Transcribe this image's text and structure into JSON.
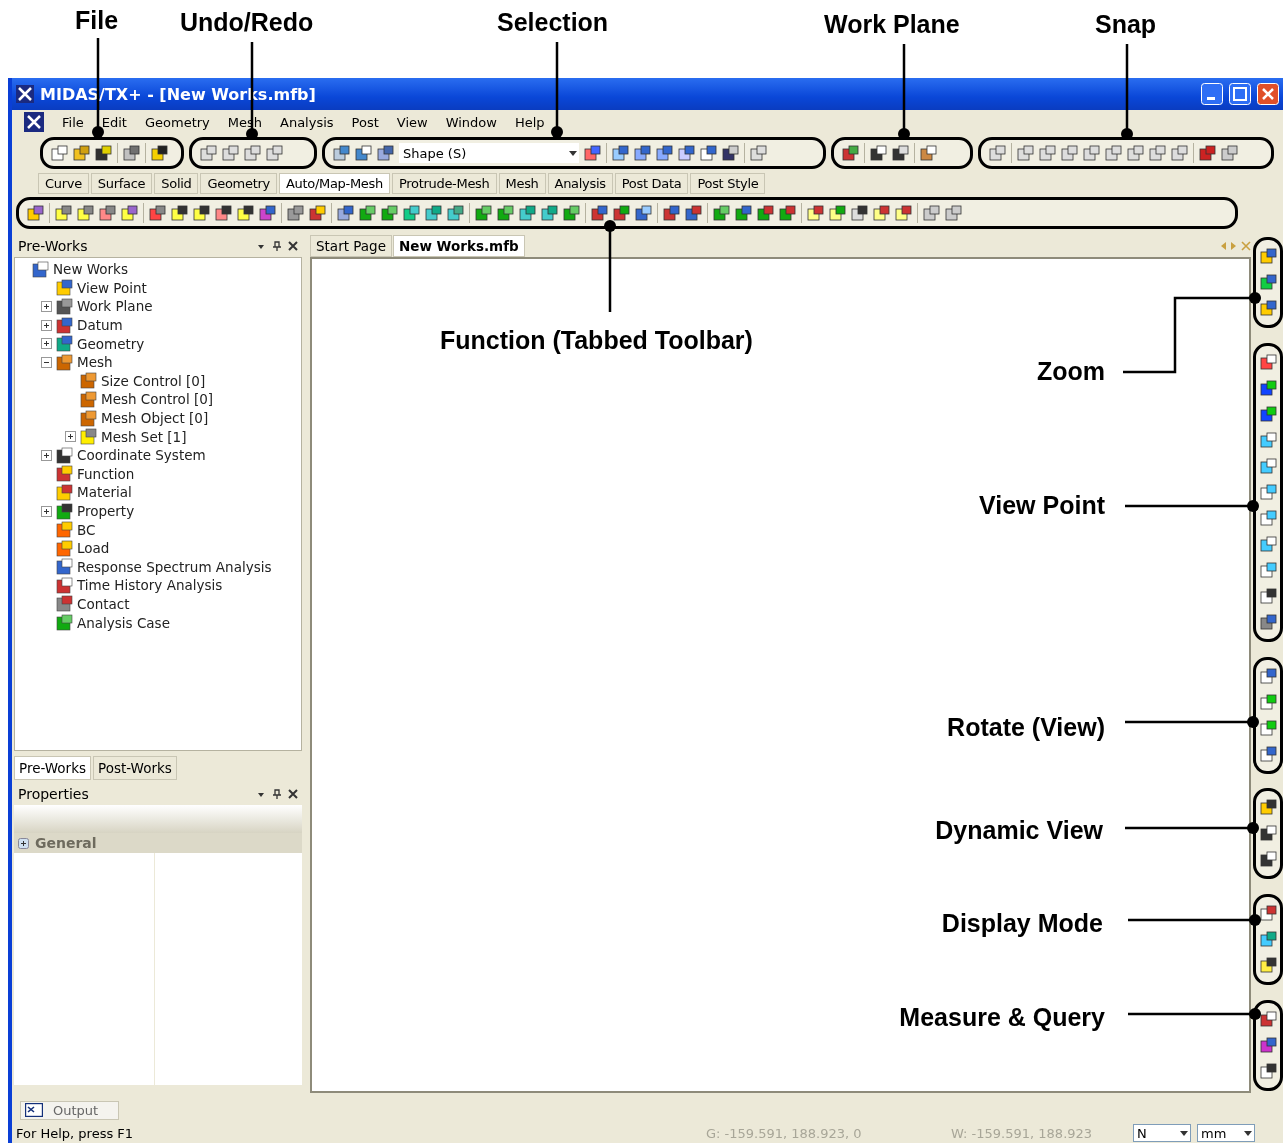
{
  "window": {
    "title": "MIDAS/TX+ - [New Works.mfb]"
  },
  "menu": [
    "File",
    "Edit",
    "Geometry",
    "Mesh",
    "Analysis",
    "Post",
    "View",
    "Window",
    "Help"
  ],
  "selection_filter": {
    "value": "Shape (S)"
  },
  "tabs": [
    {
      "label": "Curve",
      "selected": false
    },
    {
      "label": "Surface",
      "selected": false
    },
    {
      "label": "Solid",
      "selected": false
    },
    {
      "label": "Geometry",
      "selected": false
    },
    {
      "label": "Auto/Map-Mesh",
      "selected": true
    },
    {
      "label": "Protrude-Mesh",
      "selected": false
    },
    {
      "label": "Mesh",
      "selected": false
    },
    {
      "label": "Analysis",
      "selected": false
    },
    {
      "label": "Post Data",
      "selected": false
    },
    {
      "label": "Post Style",
      "selected": false
    }
  ],
  "works_panel": {
    "title": "Pre-Works",
    "tree": [
      {
        "label": "New Works",
        "children": [
          {
            "label": "View Point"
          },
          {
            "label": "Work Plane",
            "expanded": false
          },
          {
            "label": "Datum",
            "expanded": false
          },
          {
            "label": "Geometry",
            "expanded": false
          },
          {
            "label": "Mesh",
            "expanded": true,
            "children": [
              {
                "label": "Size Control [0]"
              },
              {
                "label": "Mesh Control [0]"
              },
              {
                "label": "Mesh Object [0]"
              },
              {
                "label": "Mesh Set [1]",
                "expanded": false
              }
            ]
          },
          {
            "label": "Coordinate System",
            "expanded": false
          },
          {
            "label": "Function"
          },
          {
            "label": "Material"
          },
          {
            "label": "Property",
            "expanded": false
          },
          {
            "label": "BC"
          },
          {
            "label": "Load"
          },
          {
            "label": "Response Spectrum Analysis"
          },
          {
            "label": "Time History Analysis"
          },
          {
            "label": "Contact"
          },
          {
            "label": "Analysis Case"
          }
        ]
      }
    ]
  },
  "panel_tabs": [
    {
      "label": "Pre-Works",
      "selected": true
    },
    {
      "label": "Post-Works",
      "selected": false
    }
  ],
  "properties": {
    "title": "Properties",
    "group": "General"
  },
  "documents": [
    {
      "label": "Start Page",
      "selected": false
    },
    {
      "label": "New Works.mfb",
      "selected": true
    }
  ],
  "output_tab": "Output",
  "status_bar": {
    "help": "For Help, press F1",
    "global_coords": "G: -159.591, 188.923, 0",
    "work_coords": "W: -159.591, 188.923",
    "force_unit": "N",
    "length_unit": "mm"
  },
  "callouts": [
    "File",
    "Undo/Redo",
    "Selection",
    "Work Plane",
    "Snap",
    "Function (Tabbed Toolbar)",
    "Zoom",
    "View Point",
    "Rotate (View)",
    "Dynamic View",
    "Display Mode",
    "Measure & Query"
  ]
}
